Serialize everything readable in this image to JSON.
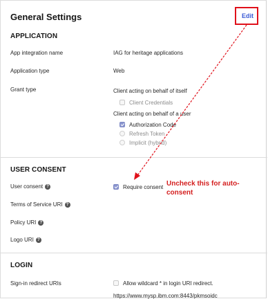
{
  "header": {
    "title": "General Settings",
    "edit_label": "Edit"
  },
  "sections": {
    "application": "APPLICATION",
    "user_consent": "USER CONSENT",
    "login": "LOGIN"
  },
  "application": {
    "name_label": "App integration name",
    "name_value": "IAG for heritage applications",
    "type_label": "Application type",
    "type_value": "Web",
    "grant_label": "Grant type",
    "grant_group1": "Client acting on behalf of itself",
    "client_credentials": "Client Credentials",
    "grant_group2": "Client acting on behalf of a user",
    "authorization_code": "Authorization Code",
    "refresh_token": "Refresh Token",
    "implicit": "Implicit (hybrid)"
  },
  "consent": {
    "user_consent_label": "User consent",
    "require_consent": "Require consent",
    "tos_label": "Terms of Service URI",
    "policy_label": "Policy URI",
    "logo_label": "Logo URI"
  },
  "login": {
    "redirect_label": "Sign-in redirect URIs",
    "wildcard_label": "Allow wildcard * in login URI redirect.",
    "redirect_uri": "https://www.mysp.ibm.com:8443/pkmsoidc"
  },
  "annotation": {
    "text": "Uncheck this for auto-consent"
  },
  "colors": {
    "annotation_red": "#d41f1f",
    "link_blue": "#3c5cd6",
    "checkbox_checked": "#8b96cf"
  }
}
